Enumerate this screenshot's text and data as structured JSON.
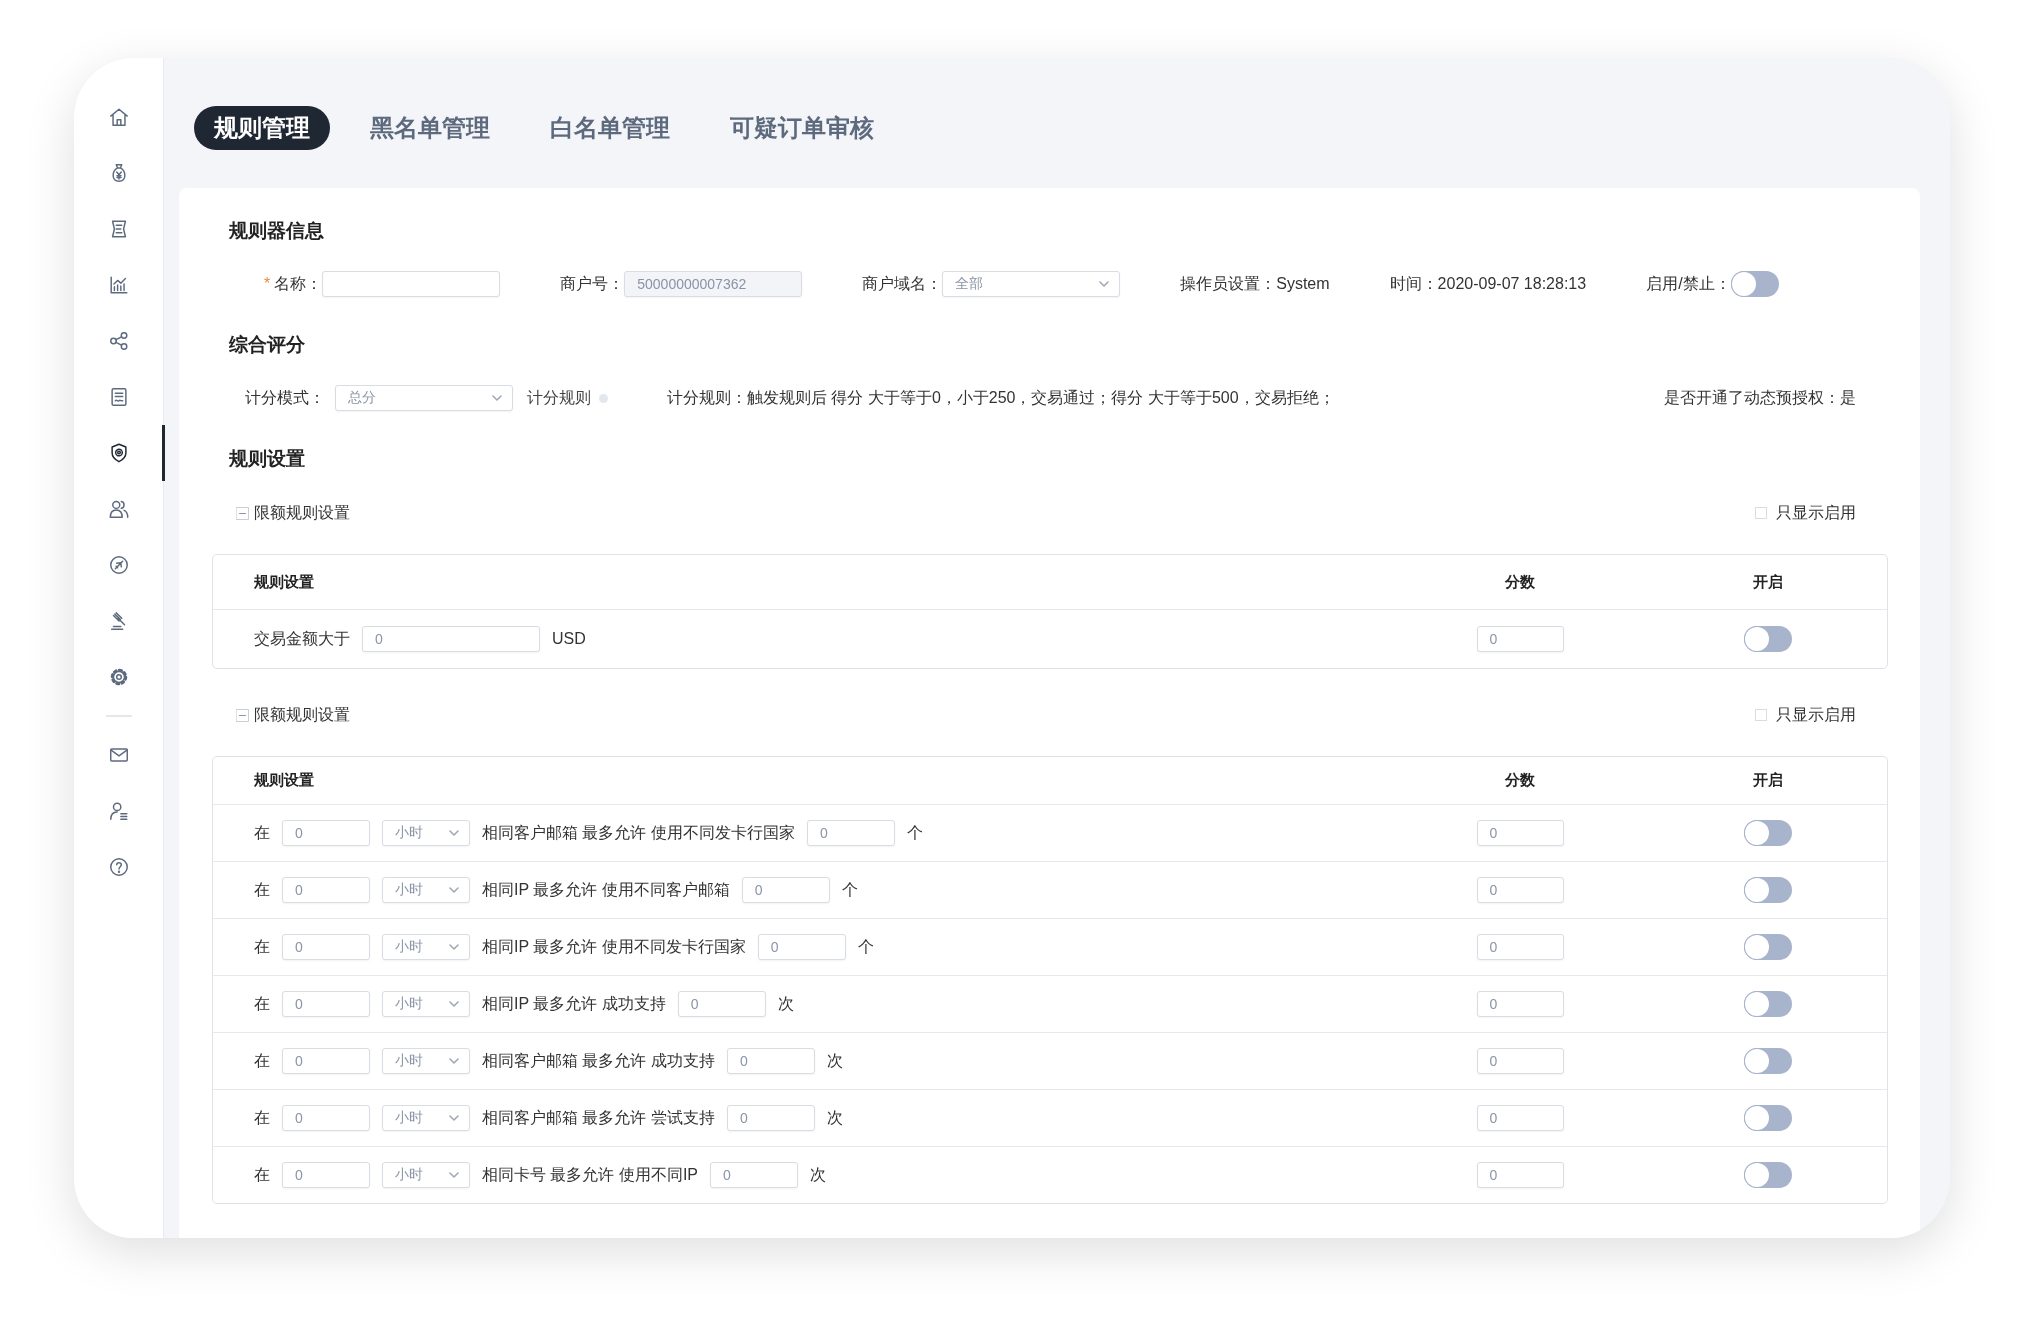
{
  "sidebar": {
    "items": [
      {
        "selected": false
      },
      {
        "selected": false
      },
      {
        "selected": false
      },
      {
        "selected": false
      },
      {
        "selected": false
      },
      {
        "selected": false
      },
      {
        "selected": true
      },
      {
        "selected": false
      },
      {
        "selected": false
      },
      {
        "selected": false
      },
      {
        "selected": false
      }
    ],
    "bottom_items": [
      {
        "selected": false
      },
      {
        "selected": false
      },
      {
        "selected": false
      }
    ]
  },
  "tabs": [
    {
      "label": "规则管理",
      "selected": true
    },
    {
      "label": "黑名单管理",
      "selected": false
    },
    {
      "label": "白名单管理",
      "selected": false
    },
    {
      "label": "可疑订单审核",
      "selected": false
    }
  ],
  "info": {
    "title": "规则器信息",
    "fields": [
      {
        "kind": "input",
        "label": "名称：",
        "required_mark": "*"
      },
      {
        "kind": "input",
        "label": "商户号：",
        "value": "50000000007362",
        "disabled": true
      },
      {
        "kind": "select",
        "label": "商户域名：",
        "value": "全部"
      },
      {
        "kind": "text",
        "text": "操作员设置：System"
      },
      {
        "kind": "text",
        "text": "时间：2020-09-07 18:28:13"
      },
      {
        "kind": "switch",
        "label": "启用/禁止：",
        "on": false
      }
    ]
  },
  "scoring": {
    "title": "综合评分",
    "mode": {
      "label": "计分模式：",
      "value": "总分"
    },
    "rule_link": "计分规则",
    "rule_text": "计分规则：触发规则后 得分 大于等于0，小于250，交易通过；得分 大于等于500，交易拒绝；",
    "preauth": "是否开通了动态预授权：是"
  },
  "rules": {
    "title": "规则设置",
    "groups": [
      {
        "label": "限额规则设置",
        "expanded": true,
        "filter": {
          "label": "只显示启用",
          "checked": false
        },
        "columns": [
          "规则设置",
          "分数",
          "开启"
        ],
        "rows": [
          {
            "parts": [
              {
                "kind": "text",
                "text": "交易金额大于"
              },
              {
                "kind": "input",
                "value": "0"
              },
              {
                "kind": "text",
                "text": "USD"
              }
            ],
            "score": "0",
            "on": false
          }
        ]
      },
      {
        "label": "限额规则设置",
        "expanded": true,
        "filter": {
          "label": "只显示启用",
          "checked": false
        },
        "columns": [
          "规则设置",
          "分数",
          "开启"
        ],
        "rows": [
          {
            "parts": [
              {
                "kind": "text",
                "text": "在"
              },
              {
                "kind": "input",
                "value": "0"
              },
              {
                "kind": "select",
                "value": "小时"
              },
              {
                "kind": "text",
                "text": "相同客户邮箱 最多允许 使用不同发卡行国家"
              },
              {
                "kind": "input",
                "value": "0"
              },
              {
                "kind": "text",
                "text": "个"
              }
            ],
            "score": "0",
            "on": false
          },
          {
            "parts": [
              {
                "kind": "text",
                "text": "在"
              },
              {
                "kind": "input",
                "value": "0"
              },
              {
                "kind": "select",
                "value": "小时"
              },
              {
                "kind": "text",
                "text": "相同IP 最多允许 使用不同客户邮箱"
              },
              {
                "kind": "input",
                "value": "0"
              },
              {
                "kind": "text",
                "text": "个"
              }
            ],
            "score": "0",
            "on": false
          },
          {
            "parts": [
              {
                "kind": "text",
                "text": "在"
              },
              {
                "kind": "input",
                "value": "0"
              },
              {
                "kind": "select",
                "value": "小时"
              },
              {
                "kind": "text",
                "text": "相同IP 最多允许 使用不同发卡行国家"
              },
              {
                "kind": "input",
                "value": "0"
              },
              {
                "kind": "text",
                "text": "个"
              }
            ],
            "score": "0",
            "on": false
          },
          {
            "parts": [
              {
                "kind": "text",
                "text": "在"
              },
              {
                "kind": "input",
                "value": "0"
              },
              {
                "kind": "select",
                "value": "小时"
              },
              {
                "kind": "text",
                "text": "相同IP 最多允许 成功支持"
              },
              {
                "kind": "input",
                "value": "0"
              },
              {
                "kind": "text",
                "text": "次"
              }
            ],
            "score": "0",
            "on": false
          },
          {
            "parts": [
              {
                "kind": "text",
                "text": "在"
              },
              {
                "kind": "input",
                "value": "0"
              },
              {
                "kind": "select",
                "value": "小时"
              },
              {
                "kind": "text",
                "text": "相同客户邮箱 最多允许 成功支持"
              },
              {
                "kind": "input",
                "value": "0"
              },
              {
                "kind": "text",
                "text": "次"
              }
            ],
            "score": "0",
            "on": false
          },
          {
            "parts": [
              {
                "kind": "text",
                "text": "在"
              },
              {
                "kind": "input",
                "value": "0"
              },
              {
                "kind": "select",
                "value": "小时"
              },
              {
                "kind": "text",
                "text": "相同客户邮箱 最多允许 尝试支持"
              },
              {
                "kind": "input",
                "value": "0"
              },
              {
                "kind": "text",
                "text": "次"
              }
            ],
            "score": "0",
            "on": false
          },
          {
            "parts": [
              {
                "kind": "text",
                "text": "在"
              },
              {
                "kind": "input",
                "value": "0"
              },
              {
                "kind": "select",
                "value": "小时"
              },
              {
                "kind": "text",
                "text": "相同卡号 最多允许 使用不同IP"
              },
              {
                "kind": "input",
                "value": "0"
              },
              {
                "kind": "text",
                "text": "次"
              }
            ],
            "score": "0",
            "on": false
          }
        ]
      }
    ]
  }
}
